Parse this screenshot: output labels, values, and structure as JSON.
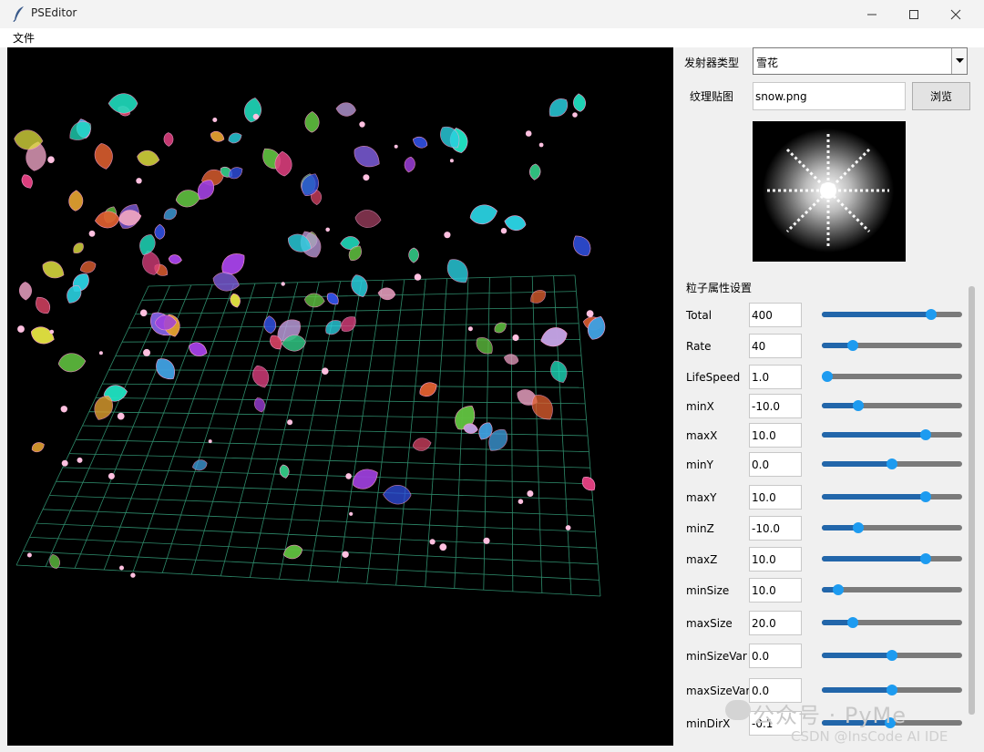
{
  "window": {
    "title": "PSEditor",
    "menu": [
      "文件"
    ]
  },
  "panel": {
    "emitter_type_label": "发射器类型",
    "emitter_type_value": "雪花",
    "texture_label": "纹理贴图",
    "texture_value": "snow.png",
    "browse_label": "浏览",
    "section_label": "粒子属性设置",
    "params": [
      {
        "name": "Total",
        "value": "400",
        "level": 0.78
      },
      {
        "name": "Rate",
        "value": "40",
        "level": 0.22
      },
      {
        "name": "LifeSpeed",
        "value": "1.0",
        "level": 0.04
      },
      {
        "name": "minX",
        "value": "-10.0",
        "level": 0.26
      },
      {
        "name": "maxX",
        "value": "10.0",
        "level": 0.74
      },
      {
        "name": "minY",
        "value": "0.0",
        "level": 0.5
      },
      {
        "name": "maxY",
        "value": "10.0",
        "level": 0.74
      },
      {
        "name": "minZ",
        "value": "-10.0",
        "level": 0.26
      },
      {
        "name": "maxZ",
        "value": "10.0",
        "level": 0.74
      },
      {
        "name": "minSize",
        "value": "10.0",
        "level": 0.12
      },
      {
        "name": "maxSize",
        "value": "20.0",
        "level": 0.22
      },
      {
        "name": "minSizeVar",
        "value": "0.0",
        "level": 0.5
      },
      {
        "name": "maxSizeVar",
        "value": "0.0",
        "level": 0.5
      },
      {
        "name": "minDirX",
        "value": "-0.1",
        "level": 0.49
      }
    ]
  },
  "watermark": {
    "line1": "公众号 · PyMe",
    "line2": "CSDN @InsCode AI IDE"
  },
  "colors": {
    "slider_fill": "#2266aa",
    "slider_thumb": "#1d9bf0",
    "grid": "#2e8b6b"
  },
  "icons": [
    "feather-icon",
    "minimize-icon",
    "maximize-icon",
    "close-icon",
    "dropdown-arrow-icon"
  ]
}
